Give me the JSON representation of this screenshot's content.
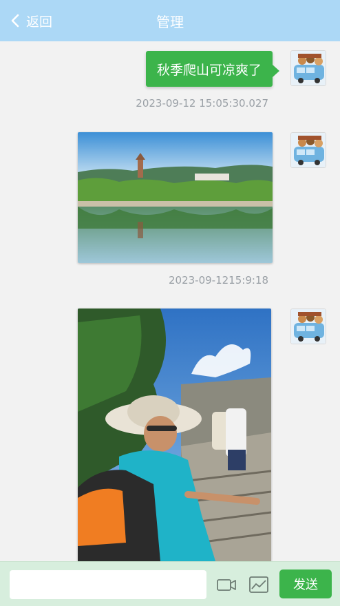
{
  "header": {
    "back_label": "返回",
    "title": "管理",
    "background": "#acd8f6"
  },
  "messages": [
    {
      "type": "text",
      "text": "秋季爬山可凉爽了",
      "timestamp": "2023-09-12 15:05:30.027"
    },
    {
      "type": "image",
      "subject": "lake-with-pagoda-landscape",
      "timestamp": "2023-09-1215:9:18"
    },
    {
      "type": "image",
      "subject": "hiker-woman-on-mountain-stairs"
    }
  ],
  "input_bar": {
    "value": "",
    "placeholder": "",
    "video_icon": "video-icon",
    "image_icon": "image-icon",
    "send_label": "发送"
  },
  "colors": {
    "accent_green": "#3cb44b",
    "timestamp_gray": "#9aa0a6",
    "input_bar_bg": "#d7eedd"
  }
}
